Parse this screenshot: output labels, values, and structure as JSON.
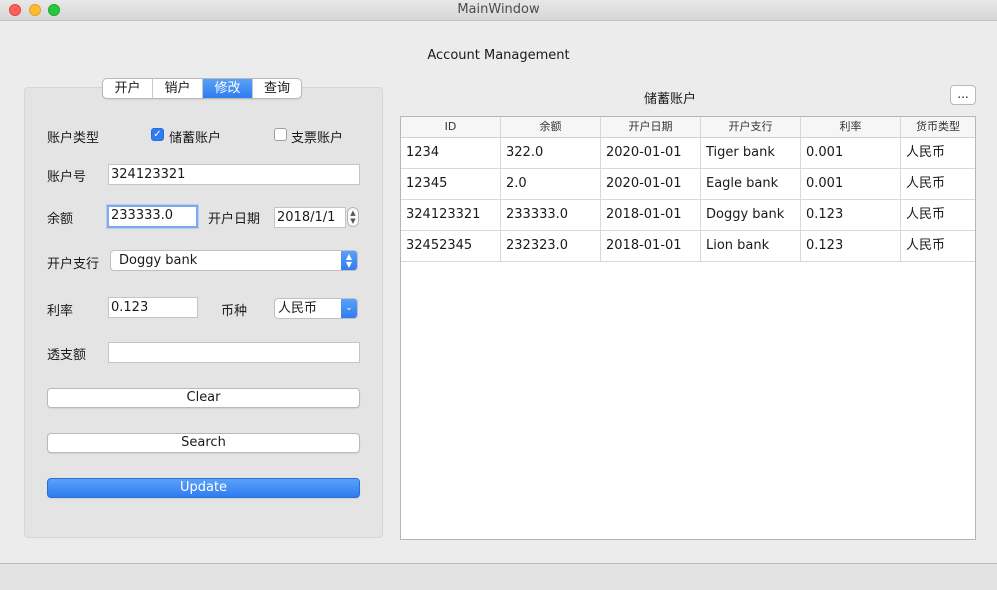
{
  "window": {
    "title": "MainWindow"
  },
  "app": {
    "title": "Account Management"
  },
  "tabs": [
    {
      "label": "开户",
      "active": false
    },
    {
      "label": "销户",
      "active": false
    },
    {
      "label": "修改",
      "active": true
    },
    {
      "label": "查询",
      "active": false
    }
  ],
  "form": {
    "account_type_label": "账户类型",
    "savings_checkbox": {
      "label": "储蓄账户",
      "checked": true
    },
    "check_checkbox": {
      "label": "支票账户",
      "checked": false
    },
    "account_no_label": "账户号",
    "account_no_value": "324123321",
    "balance_label": "余额",
    "balance_value": "233333.0",
    "open_date_label": "开户日期",
    "open_date_value": "2018/1/1",
    "branch_label": "开户支行",
    "branch_value": "Doggy bank",
    "rate_label": "利率",
    "rate_value": "0.123",
    "currency_label": "币种",
    "currency_value": "人民币",
    "overdraft_label": "透支额",
    "overdraft_value": "",
    "clear_button": "Clear",
    "search_button": "Search",
    "update_button": "Update"
  },
  "table": {
    "title": "储蓄账户",
    "more_button": "...",
    "columns": [
      "ID",
      "余额",
      "开户日期",
      "开户支行",
      "利率",
      "货币类型"
    ],
    "rows": [
      [
        "1234",
        "322.0",
        "2020-01-01",
        "Tiger bank",
        "0.001",
        "人民币"
      ],
      [
        "12345",
        "2.0",
        "2020-01-01",
        "Eagle bank",
        "0.001",
        "人民币"
      ],
      [
        "324123321",
        "233333.0",
        "2018-01-01",
        "Doggy bank",
        "0.123",
        "人民币"
      ],
      [
        "32452345",
        "232323.0",
        "2018-01-01",
        "Lion bank",
        "0.123",
        "人民币"
      ]
    ]
  },
  "colors": {
    "accent": "#2f7cf0",
    "window_bg": "#ececec"
  }
}
